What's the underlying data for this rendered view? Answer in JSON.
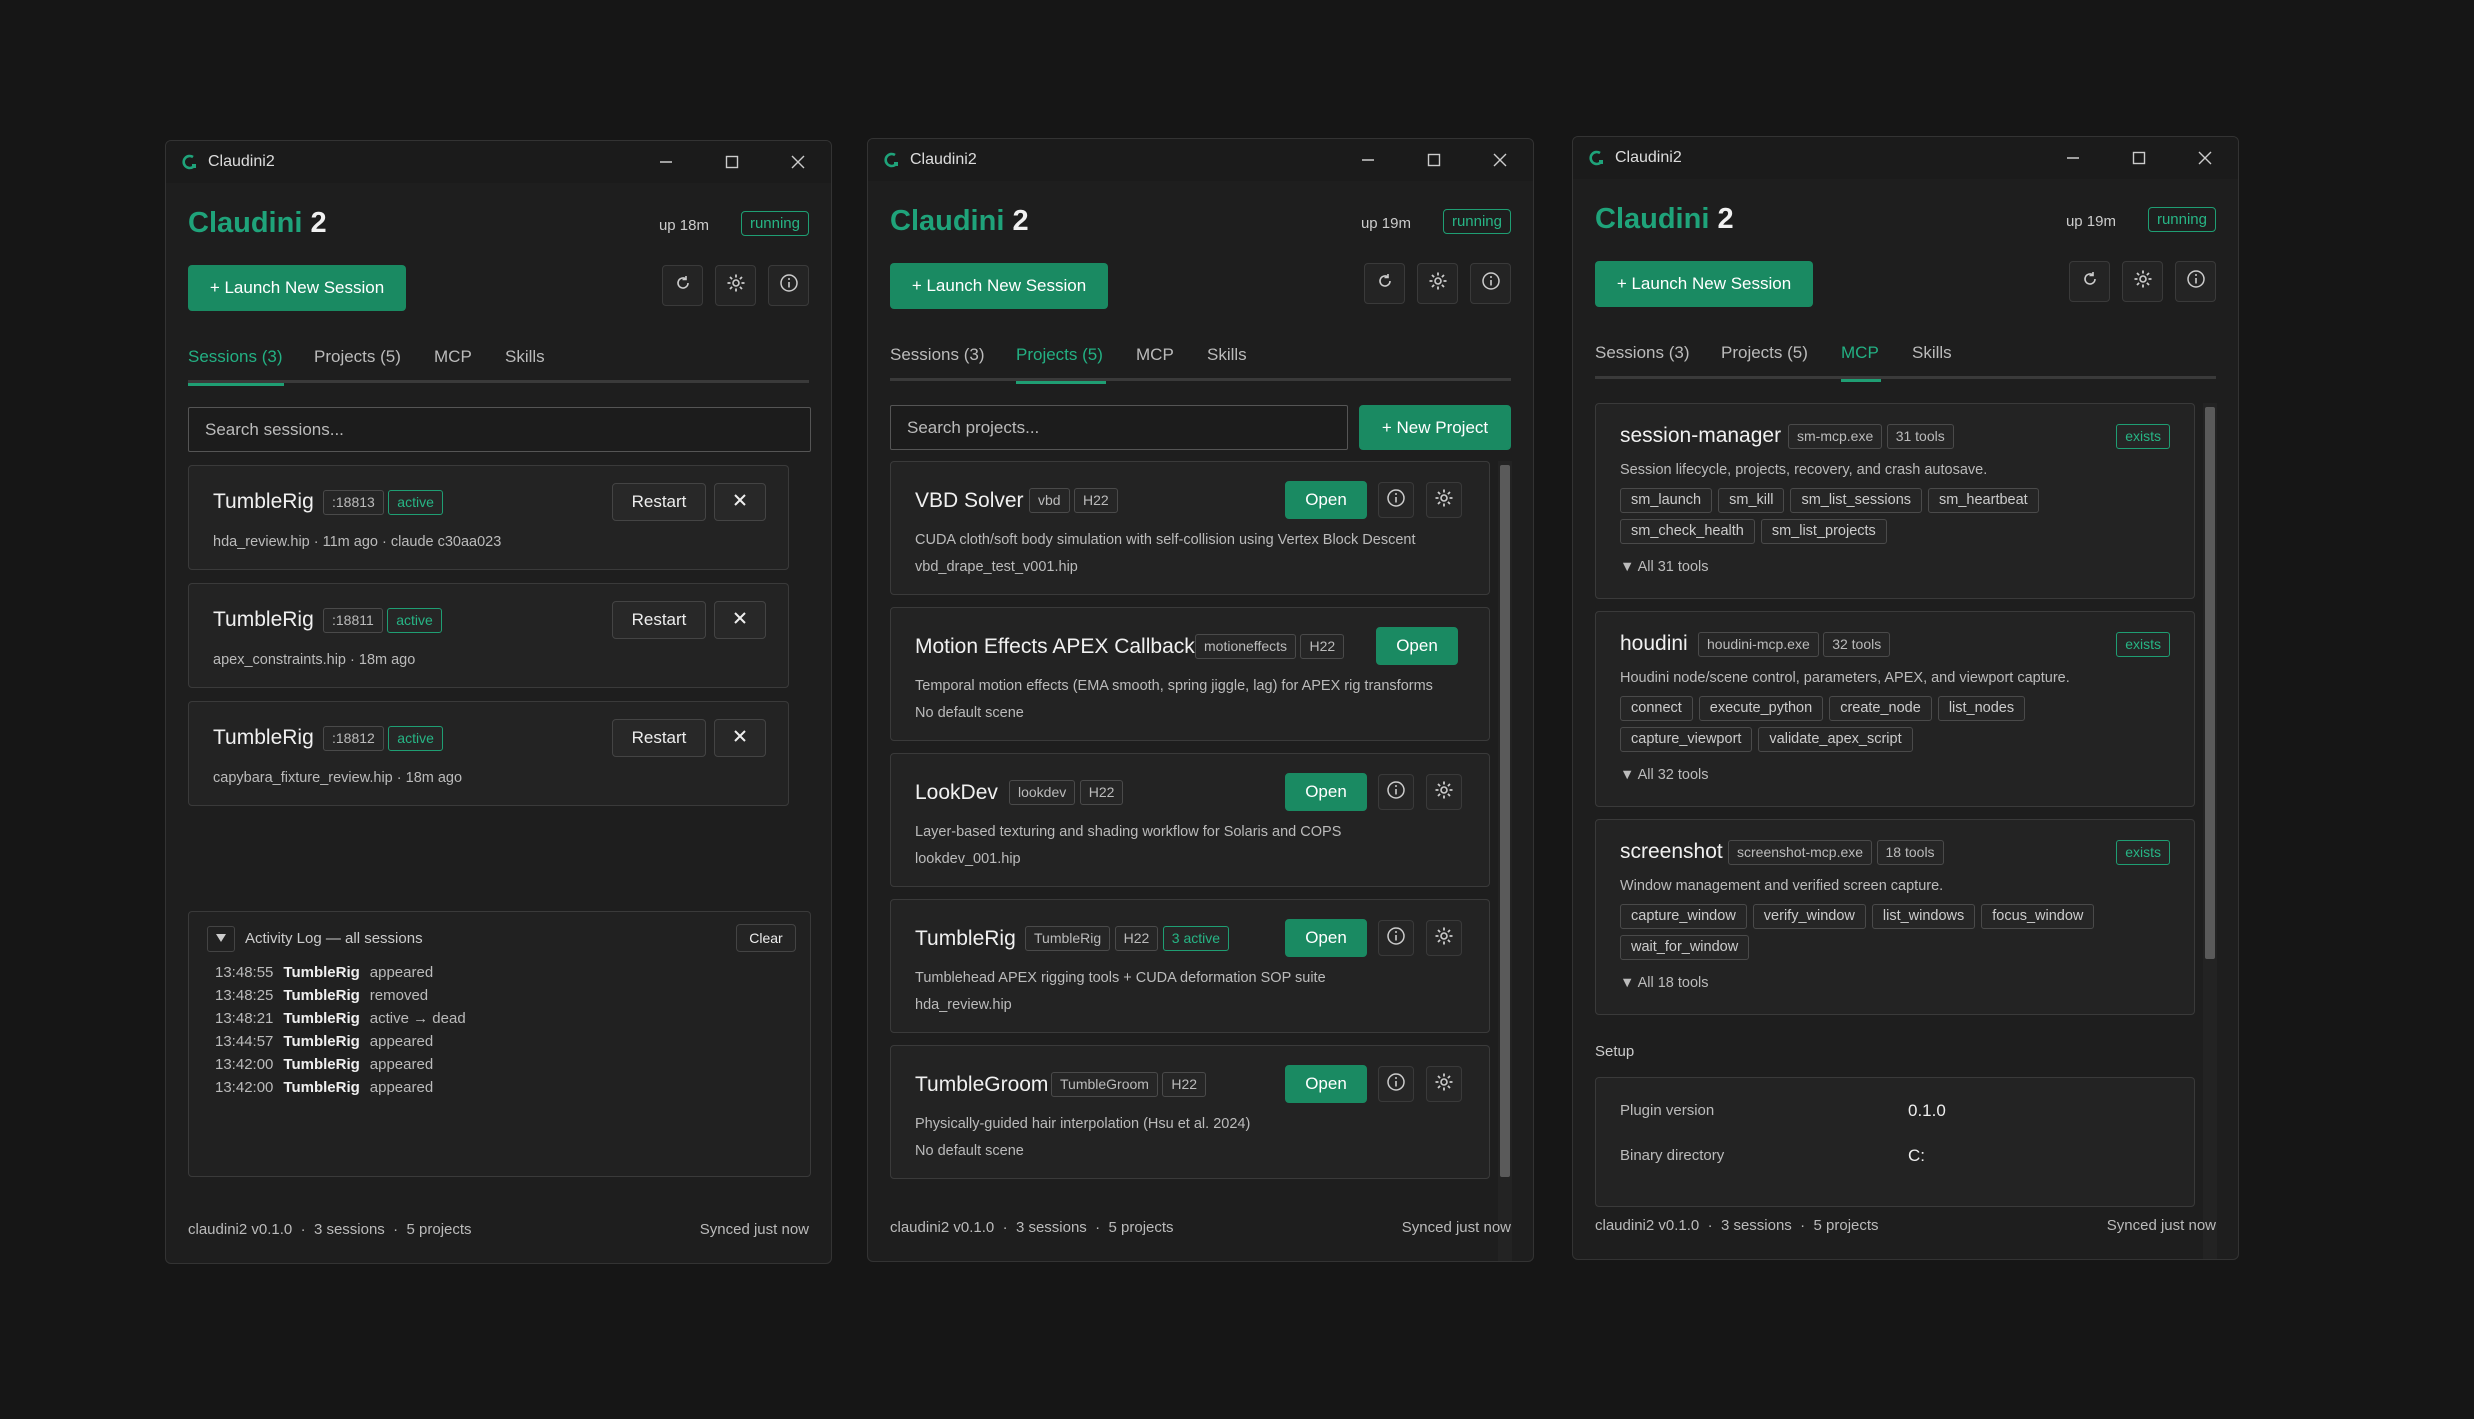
{
  "app_title": "Claudini2",
  "brand": {
    "name": "Claudini",
    "num": "2"
  },
  "status": "running",
  "launch_label": "+ Launch New Session",
  "tabs": {
    "sessions": "Sessions (3)",
    "projects": "Projects (5)",
    "mcp": "MCP",
    "skills": "Skills"
  },
  "footer": {
    "version": "claudini2 v0.1.0",
    "sessions": "3 sessions",
    "projects": "5 projects",
    "sep": "·",
    "synced": "Synced just now"
  },
  "win1": {
    "uptime": "up 18m",
    "search_placeholder": "Search sessions...",
    "sessions": [
      {
        "name": "TumbleRig",
        "port": ":18813",
        "status": "active",
        "meta": "hda_review.hip · 11m ago · claude c30aa023"
      },
      {
        "name": "TumbleRig",
        "port": ":18811",
        "status": "active",
        "meta": "apex_constraints.hip · 18m ago"
      },
      {
        "name": "TumbleRig",
        "port": ":18812",
        "status": "active",
        "meta": "capybara_fixture_review.hip · 18m ago"
      }
    ],
    "restart_label": "Restart",
    "activity": {
      "title": "Activity Log — all sessions",
      "clear": "Clear",
      "rows": [
        {
          "time": "13:48:55",
          "name": "TumbleRig",
          "event": "appeared"
        },
        {
          "time": "13:48:25",
          "name": "TumbleRig",
          "event": "removed"
        },
        {
          "time": "13:48:21",
          "name": "TumbleRig",
          "event": "active → dead"
        },
        {
          "time": "13:44:57",
          "name": "TumbleRig",
          "event": "appeared"
        },
        {
          "time": "13:42:00",
          "name": "TumbleRig",
          "event": "appeared"
        },
        {
          "time": "13:42:00",
          "name": "TumbleRig",
          "event": "appeared"
        }
      ]
    }
  },
  "win2": {
    "uptime": "up 19m",
    "search_placeholder": "Search projects...",
    "new_project": "+ New Project",
    "open_label": "Open",
    "projects": [
      {
        "name": "VBD Solver",
        "tags": [
          "vbd",
          "H22"
        ],
        "desc": "CUDA cloth/soft body simulation with self-collision using Vertex Block Descent",
        "scene": "vbd_drape_test_v001.hip"
      },
      {
        "name": "Motion Effects APEX Callback",
        "tags": [
          "motioneffects",
          "H22"
        ],
        "desc": "Temporal motion effects (EMA smooth, spring jiggle, lag) for APEX rig transforms",
        "scene": "No default scene"
      },
      {
        "name": "LookDev",
        "tags": [
          "lookdev",
          "H22"
        ],
        "desc": "Layer-based texturing and shading workflow for Solaris and COPS",
        "scene": "lookdev_001.hip"
      },
      {
        "name": "TumbleRig",
        "tags": [
          "TumbleRig",
          "H22"
        ],
        "badge": "3 active",
        "desc": "Tumblehead APEX rigging tools + CUDA deformation SOP suite",
        "scene": "hda_review.hip"
      },
      {
        "name": "TumbleGroom",
        "tags": [
          "TumbleGroom",
          "H22"
        ],
        "desc": "Physically-guided hair interpolation (Hsu et al. 2024)",
        "scene": "No default scene"
      }
    ]
  },
  "win3": {
    "uptime": "up 19m",
    "exists_label": "exists",
    "servers": [
      {
        "name": "session-manager",
        "exe": "sm-mcp.exe",
        "count": "31 tools",
        "desc": "Session lifecycle, projects, recovery, and crash autosave.",
        "rows": [
          [
            "sm_launch",
            "sm_kill",
            "sm_list_sessions",
            "sm_heartbeat"
          ],
          [
            "sm_check_health",
            "sm_list_projects"
          ]
        ],
        "more": "▼ All 31 tools"
      },
      {
        "name": "houdini",
        "exe": "houdini-mcp.exe",
        "count": "32 tools",
        "desc": "Houdini node/scene control, parameters, APEX, and viewport capture.",
        "rows": [
          [
            "connect",
            "execute_python",
            "create_node",
            "list_nodes"
          ],
          [
            "capture_viewport",
            "validate_apex_script"
          ]
        ],
        "more": "▼ All 32 tools"
      },
      {
        "name": "screenshot",
        "exe": "screenshot-mcp.exe",
        "count": "18 tools",
        "desc": "Window management and verified screen capture.",
        "rows": [
          [
            "capture_window",
            "verify_window",
            "list_windows",
            "focus_window"
          ],
          [
            "wait_for_window"
          ]
        ],
        "more": "▼ All 18 tools"
      }
    ],
    "setup": {
      "title": "Setup",
      "plugin_label": "Plugin version",
      "plugin_value": "0.1.0",
      "bin_label": "Binary directory",
      "bin_value": "C:"
    }
  }
}
